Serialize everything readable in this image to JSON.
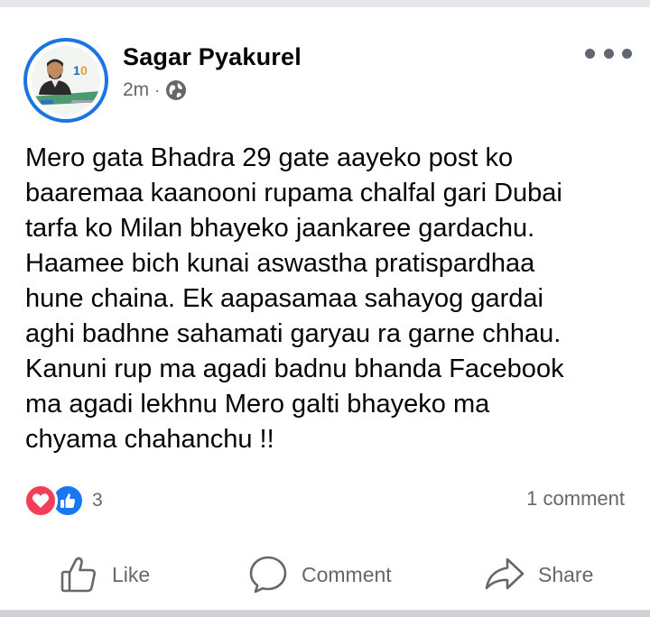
{
  "post": {
    "author": "Sagar Pyakurel",
    "time": "2m",
    "separator": "·",
    "privacy_icon": "globe-icon",
    "more_icon": "more-options-icon",
    "text_lines": [
      "Mero gata Bhadra 29 gate aayeko post ko",
      "baaremaa kaanooni rupama chalfal gari Dubai",
      "tarfa ko Milan bhayeko jaankaree gardachu.",
      "Haamee bich kunai aswastha pratispardhaa",
      "hune chaina. Ek aapasamaa sahayog gardai",
      "aghi badhne sahamati garyau ra garne chhau.",
      "Kanuni rup ma agadi badnu bhanda Facebook",
      "ma agadi lekhnu Mero galti bhayeko ma",
      "chyama chahanchu !!"
    ]
  },
  "reactions": {
    "icons": [
      "love-icon",
      "like-icon"
    ],
    "count": "3"
  },
  "comments": "1 comment",
  "actions": {
    "like": "Like",
    "comment": "Comment",
    "share": "Share"
  },
  "colors": {
    "accent": "#1877f2",
    "love": "#f33e58",
    "secondary_text": "#65676b",
    "avatar_ring": "#1b74e4"
  }
}
